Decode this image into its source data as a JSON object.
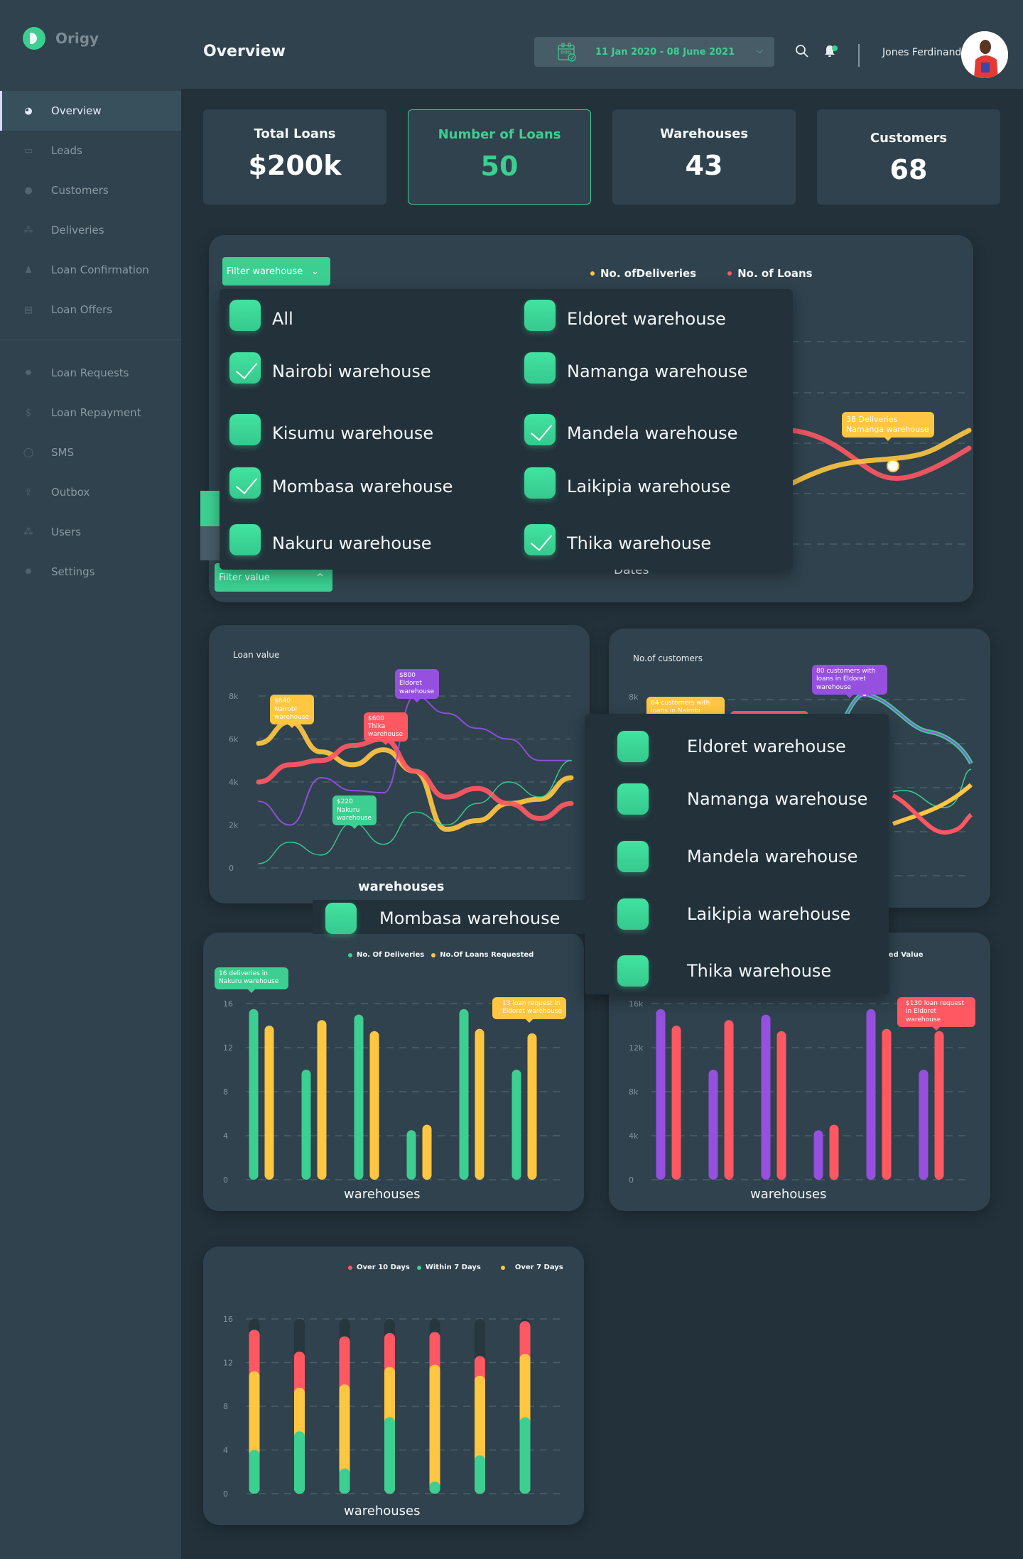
{
  "app": {
    "name": "Origy"
  },
  "sidebar": {
    "items": [
      {
        "label": "Overview",
        "icon": "pie-chart-icon",
        "glyph": "◕",
        "active": true
      },
      {
        "label": "Leads",
        "icon": "ticket-icon",
        "glyph": "▭"
      },
      {
        "label": "Customers",
        "icon": "lightbulb-icon",
        "glyph": "●"
      },
      {
        "label": "Deliveries",
        "icon": "users-icon",
        "glyph": "⁂"
      },
      {
        "label": "Loan Confirmation",
        "icon": "user-tie-icon",
        "glyph": "♟"
      },
      {
        "label": "Loan Offers",
        "icon": "book-icon",
        "glyph": "▤"
      }
    ],
    "items2": [
      {
        "label": "Loan Requests",
        "icon": "gear-icon",
        "glyph": "✹"
      },
      {
        "label": "Loan Repayment",
        "icon": "hand-money-icon",
        "glyph": "$"
      },
      {
        "label": "SMS",
        "icon": "sms-bubble-icon",
        "glyph": "◯"
      },
      {
        "label": "Outbox",
        "icon": "outbox-icon",
        "glyph": "⇪"
      },
      {
        "label": "Users",
        "icon": "users-icon",
        "glyph": "⁂"
      },
      {
        "label": "Settings",
        "icon": "gear-icon",
        "glyph": "✹"
      }
    ]
  },
  "header": {
    "title": "Overview",
    "date_range": "11 Jan 2020 - 08 June 2021",
    "user_name": "Jones Ferdinand"
  },
  "stats": [
    {
      "label": "Total Loans",
      "value": "$200k"
    },
    {
      "label": "Number of Loans",
      "value": "50",
      "active": true
    },
    {
      "label": "Warehouses",
      "value": "43"
    },
    {
      "label": "Customers",
      "value": "68"
    }
  ],
  "top_chart": {
    "filter_warehouse_label": "Filter warehouse",
    "filter_value_label": "Filter value",
    "legend": [
      {
        "label": "No. ofDeliveries",
        "color": "#ffc642"
      },
      {
        "label": "No. of Loans",
        "color": "#ff5863"
      }
    ],
    "xlabel": "Dates",
    "tooltip": "38 Deliveries Namanga warehouse",
    "tooltip_line1": "38 Deliveries",
    "tooltip_line2": "Namanga warehouse",
    "dropdown": [
      {
        "label": "All",
        "checked": false
      },
      {
        "label": "Eldoret warehouse",
        "checked": false
      },
      {
        "label": "Nairobi warehouse",
        "checked": true
      },
      {
        "label": "Namanga warehouse",
        "checked": false
      },
      {
        "label": "Kisumu warehouse",
        "checked": false
      },
      {
        "label": "Mandela warehouse",
        "checked": true
      },
      {
        "label": "Mombasa warehouse",
        "checked": true
      },
      {
        "label": "Laikipia warehouse",
        "checked": false
      },
      {
        "label": "Nakuru warehouse",
        "checked": false
      },
      {
        "label": "Thika warehouse",
        "checked": true
      }
    ]
  },
  "second_dropdown": [
    {
      "label": "Mombasa warehouse"
    },
    {
      "label": "Eldoret warehouse"
    },
    {
      "label": "Namanga warehouse"
    },
    {
      "label": "Mandela warehouse"
    },
    {
      "label": "Laikipia warehouse"
    },
    {
      "label": "Thika warehouse"
    }
  ],
  "colors": {
    "green": "#3ccf91",
    "yellow": "#ffc642",
    "red": "#ff5863",
    "purple": "#9650df"
  },
  "chart_data": [
    {
      "id": "loan-value",
      "type": "line",
      "title": "Loan value",
      "xlabel": "warehouses",
      "ylabel": "",
      "yticks": [
        "0",
        "2k",
        "4k",
        "6k",
        "8k"
      ],
      "ylim": [
        0,
        8000
      ],
      "series": [
        {
          "name": "yellow",
          "color": "#ffc642",
          "values": [
            5800,
            6800,
            5400,
            4800,
            5500,
            4500,
            1800,
            2200,
            3000,
            3200,
            4200
          ]
        },
        {
          "name": "red",
          "color": "#ff5863",
          "values": [
            4000,
            4800,
            5000,
            5700,
            6000,
            4500,
            3300,
            3700,
            3000,
            2300,
            3000
          ]
        },
        {
          "name": "purple",
          "color": "#9650df",
          "values": [
            3100,
            2000,
            4200,
            3600,
            3500,
            8000,
            7200,
            6500,
            6000,
            5000,
            5000
          ]
        },
        {
          "name": "green",
          "color": "#3ccf91",
          "values": [
            200,
            1200,
            600,
            2100,
            1100,
            2600,
            2000,
            3000,
            4000,
            3300,
            5000
          ]
        }
      ],
      "annotations": [
        {
          "text": "$640 Nairobi warehouse",
          "color": "#ffc642"
        },
        {
          "text": "$600 Thika warehouse",
          "color": "#ff5863"
        },
        {
          "text": "$800 Eldoret warehouse",
          "color": "#9650df"
        },
        {
          "text": "$220 Nakuru warehouse",
          "color": "#3ccf91"
        }
      ]
    },
    {
      "id": "customers",
      "type": "line",
      "title": "No.of customers",
      "yticks": [
        "8k"
      ],
      "annotations": [
        {
          "text": "64 customers with  loans in Nairobi warehouse",
          "color": "#ffc642"
        },
        {
          "text": "80 customers with  loans in Eldoret warehouse",
          "color": "#9650df"
        }
      ]
    },
    {
      "id": "deliveries-loans",
      "type": "bar",
      "xlabel": "warehouses",
      "yticks": [
        "0",
        "4",
        "8",
        "12",
        "16"
      ],
      "ylim": [
        0,
        16
      ],
      "legend": [
        "No. Of Deliveries",
        "No.Of Loans Requested"
      ],
      "series": [
        {
          "name": "No. Of Deliveries",
          "color": "#3ccf91",
          "values": [
            15.5,
            10,
            15,
            4.5,
            15.5,
            10
          ]
        },
        {
          "name": "No.Of Loans Requested",
          "color": "#ffc642",
          "values": [
            14,
            14.5,
            13.5,
            5,
            13.7,
            13.3
          ]
        }
      ],
      "annotations": [
        {
          "text": "16 deliveries in Nakuru warehouse",
          "color": "#3ccf91"
        },
        {
          "text": "13 loan request in Eldoret warehouse",
          "color": "#ffc642"
        }
      ]
    },
    {
      "id": "loan-value-bars",
      "type": "bar",
      "xlabel": "warehouses",
      "yticks": [
        "0",
        "4k",
        "8k",
        "12k",
        "16k"
      ],
      "ylim": [
        0,
        16000
      ],
      "legend_partial": "ted Value",
      "series": [
        {
          "name": "purple",
          "color": "#9650df",
          "values": [
            15500,
            10000,
            15000,
            4500,
            15500,
            10000
          ]
        },
        {
          "name": "red",
          "color": "#ff5863",
          "values": [
            14000,
            14500,
            13500,
            5000,
            13700,
            13500
          ]
        }
      ],
      "annotations": [
        {
          "text": "$130 loan request in Eldoret warehouse",
          "color": "#ff5863"
        }
      ]
    },
    {
      "id": "repayment-stacked",
      "type": "bar",
      "stacked": true,
      "xlabel": "warehouses",
      "yticks": [
        "0",
        "4",
        "8",
        "12",
        "16"
      ],
      "ylim": [
        0,
        16
      ],
      "legend": [
        "Over 10 Days",
        "Within 7 Days",
        "Over 7 Days"
      ],
      "series": [
        {
          "name": "Within 7 Days",
          "color": "#3ccf91",
          "values": [
            4,
            5.7,
            2.3,
            7,
            1.1,
            3.5,
            7
          ]
        },
        {
          "name": "Over 7 Days",
          "color": "#ffc642",
          "values": [
            7.2,
            4,
            7.7,
            4.6,
            10.7,
            7.3,
            5.8
          ]
        },
        {
          "name": "Over 10 Days",
          "color": "#ff5863",
          "values": [
            3.8,
            3.3,
            4.4,
            3.1,
            3.0,
            1.8,
            3.0
          ]
        }
      ]
    }
  ]
}
